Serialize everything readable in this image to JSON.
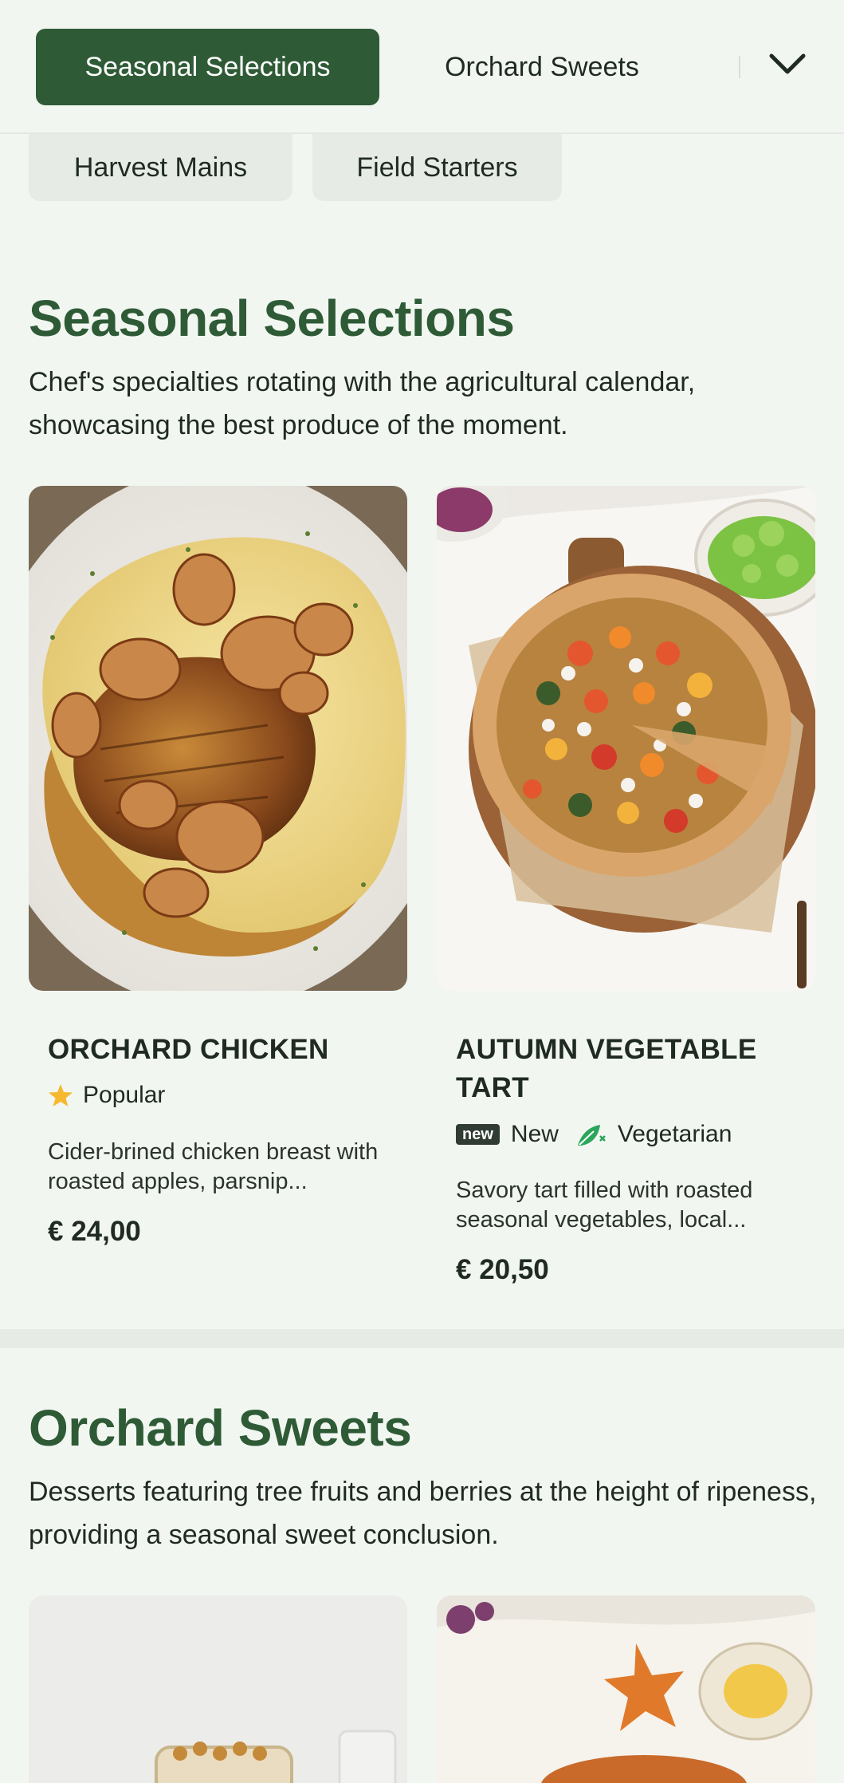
{
  "nav": {
    "tabs": [
      "Seasonal Selections",
      "Orchard Sweets"
    ],
    "active_index": 0,
    "more_icon": "chevron-down-icon"
  },
  "chips": [
    "Harvest Mains",
    "Field Starters"
  ],
  "sections": [
    {
      "title": "Seasonal Selections",
      "description": "Chef's specialties rotating with the agricultural calendar, showcasing the best produce of the moment.",
      "items": [
        {
          "name": "ORCHARD CHICKEN",
          "tags": [
            {
              "icon": "star-icon",
              "label": "Popular"
            }
          ],
          "description": "Cider-brined chicken breast with roasted apples, parsnip...",
          "price": "€ 24,00"
        },
        {
          "name": "AUTUMN VEGETABLE TART",
          "tags": [
            {
              "icon": "new-badge",
              "badge": "new",
              "label": "New"
            },
            {
              "icon": "vegetarian-leaf-icon",
              "label": "Vegetarian"
            }
          ],
          "description": "Savory tart filled with roasted seasonal vegetables, local...",
          "price": "€ 20,50"
        }
      ]
    },
    {
      "title": "Orchard Sweets",
      "description": "Desserts featuring tree fruits and berries at the height of ripeness, providing a seasonal sweet conclusion."
    }
  ],
  "colors": {
    "background": "#f2f6f1",
    "accent": "#2e5b36",
    "chip": "#e6ebe5",
    "star": "#f5b82e",
    "leaf": "#2aa65a"
  }
}
